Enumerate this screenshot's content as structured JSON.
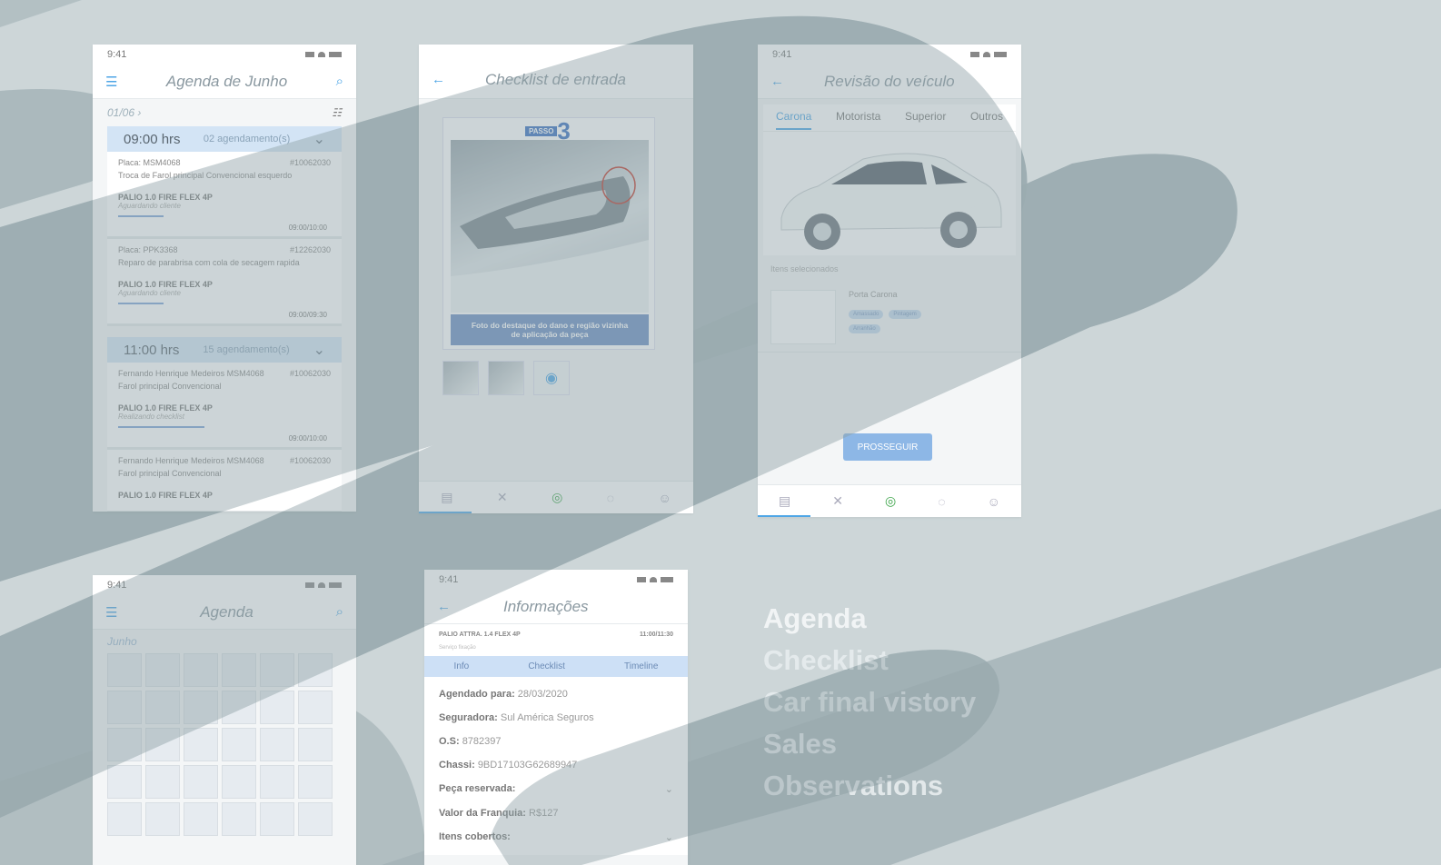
{
  "agenda_phone": {
    "status_time": "9:41",
    "title": "Agenda de Junho",
    "date": "01/06 ›",
    "slots": [
      {
        "hours": "09:00 hrs",
        "count": "02 agendamento(s)",
        "cards": [
          {
            "left": "Placa: MSM4068",
            "id": "#10062030",
            "desc": "Troca de Farol principal Convencional esquerdo",
            "model": "PALIO 1.0 FIRE FLEX 4P",
            "status": "Aguardando cliente",
            "time": "09:00/10:00"
          },
          {
            "left": "Placa: PPK3368",
            "id": "#12262030",
            "desc": "Reparo de parabrisa com cola de secagem rapida",
            "model": "PALIO 1.0 FIRE FLEX 4P",
            "status": "Aguardando cliente",
            "time": "09:00/09:30"
          }
        ]
      },
      {
        "hours": "11:00 hrs",
        "count": "15 agendamento(s)",
        "cards": [
          {
            "left": "Fernando Henrique Medeiros    MSM4068",
            "id": "#10062030",
            "desc": "Farol principal Convencional",
            "model": "PALIO 1.0 FIRE FLEX 4P",
            "status": "Realizando checklist",
            "time": "09:00/10:00"
          },
          {
            "left": "Fernando Henrique Medeiros    MSM4068",
            "id": "#10062030",
            "desc": "Farol principal Convencional",
            "model": "PALIO 1.0 FIRE FLEX 4P",
            "status": "",
            "time": ""
          }
        ]
      }
    ]
  },
  "checklist_phone": {
    "title": "Checklist de entrada",
    "step_label": "PASSO",
    "step_number": "3",
    "caption": "Foto do destaque do dano e região vizinha de aplicação da peça"
  },
  "review_phone": {
    "status_time": "9:41",
    "title": "Revisão do veículo",
    "tabs": [
      "Carona",
      "Motorista",
      "Superior",
      "Outros"
    ],
    "items_label": "Itens selecionados",
    "part_name": "Porta Carona",
    "chips": [
      "Amassado",
      "Pintagem",
      "Arranhão"
    ],
    "button": "PROSSEGUIR"
  },
  "calendar_phone": {
    "status_time": "9:41",
    "title": "Agenda",
    "month": "Junho"
  },
  "info_phone": {
    "status_time": "9:41",
    "title": "Informações",
    "vehicle": "PALIO ATTRA. 1.4 FLEX 4P",
    "vehicle_time": "11:00/11:30",
    "sub": "Serviço fixação",
    "tabs": [
      "Info",
      "Checklist",
      "Timeline"
    ],
    "rows": [
      {
        "label": "Agendado para:",
        "value": "28/03/2020"
      },
      {
        "label": "Seguradora:",
        "value": "Sul América Seguros"
      },
      {
        "label": "O.S:",
        "value": "8782397"
      },
      {
        "label": "Chassi:",
        "value": "9BD17103G62689947"
      },
      {
        "label": "Peça reservada:",
        "value": ""
      },
      {
        "label": "Valor da Franquia:",
        "value": "R$127"
      },
      {
        "label": "Itens cobertos:",
        "value": ""
      }
    ]
  },
  "menu": [
    "Agenda",
    "Checklist",
    "Car final vistory",
    "Sales",
    "Observations"
  ],
  "colors": {
    "background": "#cdd6d8",
    "band": "#a5b4b8",
    "accent": "#4fa6e6"
  }
}
